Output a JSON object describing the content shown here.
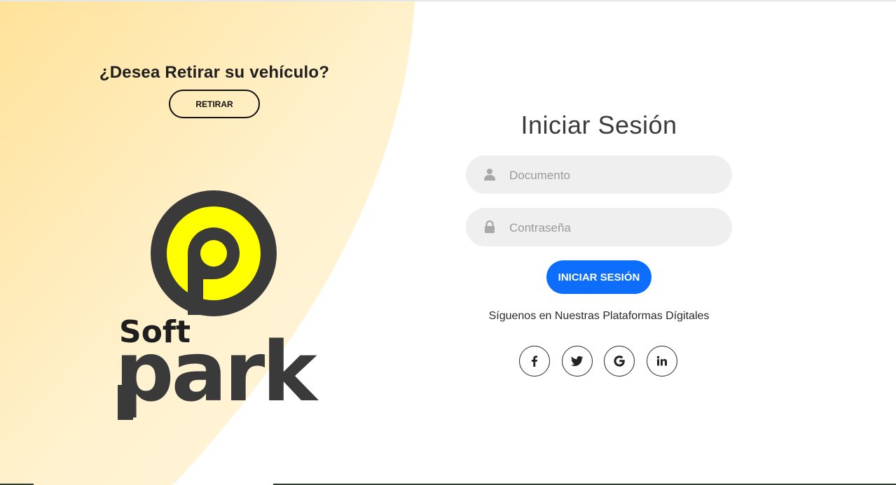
{
  "colors": {
    "accent_blue": "#0d6efd",
    "blob_light": "#fff2cf",
    "blob_warm": "#ffe29a",
    "logo_yellow": "#ffff00",
    "logo_dark": "#3a3a3a"
  },
  "left": {
    "withdraw_title": "¿Desea Retirar su vehículo?",
    "withdraw_button_label": "RETIRAR",
    "logo": {
      "word_top": "Soft",
      "word_bottom": "park"
    }
  },
  "login": {
    "title": "Iniciar Sesión",
    "username": {
      "placeholder": "Documento",
      "value": "",
      "icon": "user-icon"
    },
    "password": {
      "placeholder": "Contraseña",
      "value": "",
      "icon": "lock-icon"
    },
    "submit_label": "INICIAR SESIÓN",
    "follow_text": "Síguenos en Nuestras Plataformas Dígitales",
    "social": [
      {
        "name": "facebook",
        "icon": "facebook-icon"
      },
      {
        "name": "twitter",
        "icon": "twitter-icon"
      },
      {
        "name": "google",
        "icon": "google-icon"
      },
      {
        "name": "linkedin",
        "icon": "linkedin-icon"
      }
    ]
  }
}
